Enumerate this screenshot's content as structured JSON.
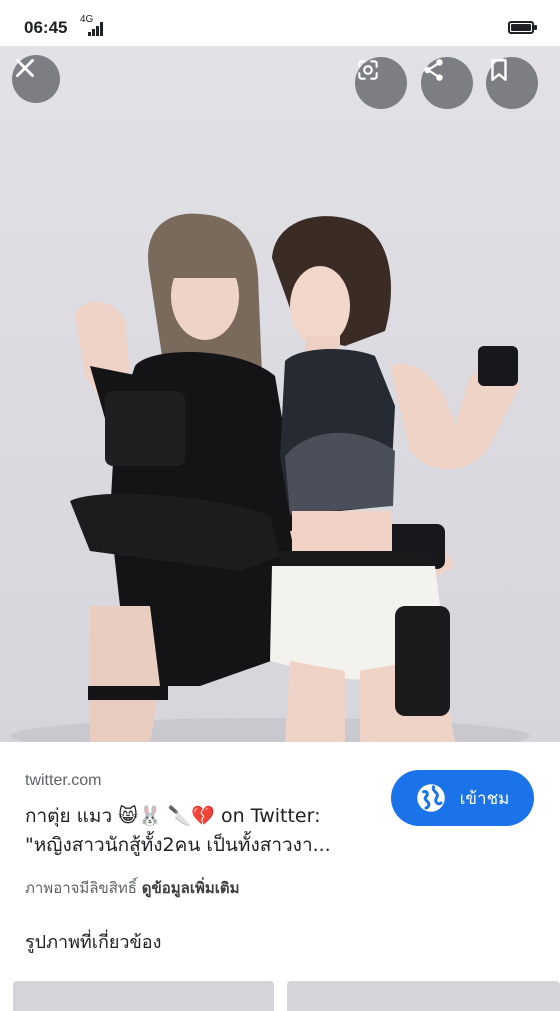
{
  "status_bar": {
    "time": "06:45",
    "signal": "4G"
  },
  "viewer": {
    "close_icon": "close-icon",
    "lens_icon": "lens-icon",
    "share_icon": "share-icon",
    "bookmark_icon": "bookmark-icon"
  },
  "result": {
    "source": "twitter.com",
    "title_line1": "กาตุ่ย แมว 😸🐰 🔪💔 on Twitter:",
    "title_line2": "\"หญิงสาวนักสู้ทั้ง2คน เป็นทั้งสาวงา...",
    "copyright_note": "ภาพอาจมีลิขสิทธิ์",
    "more_info": "ดูข้อมูลเพิ่มเติม",
    "visit_label": "เข้าชม",
    "related_heading": "รูปภาพที่เกี่ยวข้อง"
  },
  "colors": {
    "accent": "#1a73e8",
    "overlay_button": "#5f6368"
  }
}
